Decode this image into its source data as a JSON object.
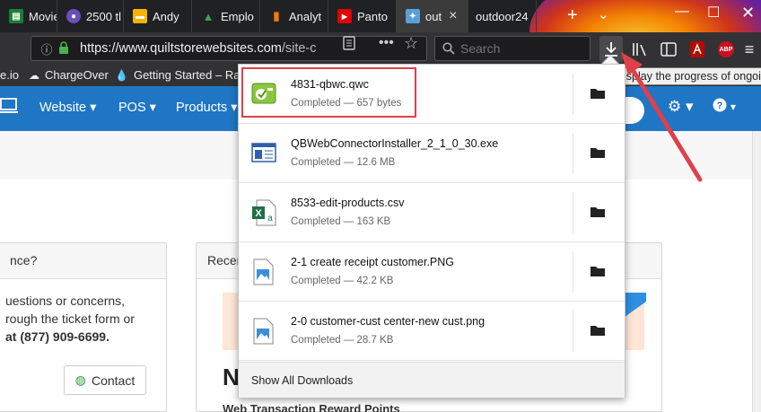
{
  "tabs": [
    {
      "label": "Movie",
      "fav_color": "#1e7e34",
      "fav_glyph": "▤"
    },
    {
      "label": "2500 tl",
      "fav_color": "#6b4fb8",
      "fav_glyph": "●"
    },
    {
      "label": "Andy",
      "fav_color": "#f4b400",
      "fav_glyph": "▬"
    },
    {
      "label": "Emplo",
      "fav_color": "#34a853",
      "fav_glyph": "▲"
    },
    {
      "label": "Analyt",
      "fav_color": "#f57c00",
      "fav_glyph": "▮"
    },
    {
      "label": "Panto",
      "fav_color": "#e00000",
      "fav_glyph": "▶"
    },
    {
      "label": "out",
      "fav_color": "#5aa0d8",
      "fav_glyph": "✦"
    },
    {
      "label": "outdoor24",
      "fav_color": "",
      "fav_glyph": ""
    }
  ],
  "url": {
    "host": "https://www.quiltstorewebsites.com",
    "path": "/site-c"
  },
  "search": {
    "placeholder": "Search"
  },
  "bookmarks": [
    {
      "label": "e.io"
    },
    {
      "label": "ChargeOver"
    },
    {
      "label": "Getting Started – Rain ..."
    }
  ],
  "tooltip": "Display the progress of ongoing downloads",
  "site_nav": {
    "items": [
      "Website ▾",
      "POS ▾",
      "Products ▾"
    ]
  },
  "support": {
    "card_title": "nce?",
    "lines": [
      "uestions or concerns,",
      "rough the ticket form or",
      "at (877) 909-6699."
    ],
    "contact_label": "Contact"
  },
  "recent": {
    "card_title": "Recen"
  },
  "page_heading": "N",
  "page_sub": "Web Transaction Reward Points",
  "downloads": {
    "items": [
      {
        "name": "4831-qbwc.qwc",
        "status": "Completed — 657 bytes",
        "icon": "qwc-file-icon"
      },
      {
        "name": "QBWebConnectorInstaller_2_1_0_30.exe",
        "status": "Completed — 12.6 MB",
        "icon": "exe-file-icon"
      },
      {
        "name": "8533-edit-products.csv",
        "status": "Completed — 163 KB",
        "icon": "excel-file-icon"
      },
      {
        "name": "2-1 create receipt customer.PNG",
        "status": "Completed — 42.2 KB",
        "icon": "image-file-icon"
      },
      {
        "name": "2-0 customer-cust center-new cust.png",
        "status": "Completed — 28.7 KB",
        "icon": "image-file-icon"
      }
    ],
    "footer": "Show All Downloads"
  }
}
